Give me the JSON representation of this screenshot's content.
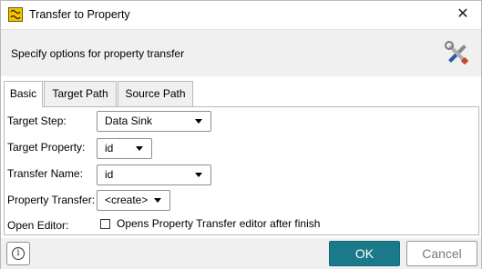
{
  "window": {
    "title": "Transfer to Property"
  },
  "header": {
    "description": "Specify options for property transfer"
  },
  "tabs": [
    {
      "label": "Basic",
      "active": true
    },
    {
      "label": "Target Path",
      "active": false
    },
    {
      "label": "Source Path",
      "active": false
    }
  ],
  "form": {
    "target_step": {
      "label": "Target Step:",
      "value": "Data Sink"
    },
    "target_property": {
      "label": "Target Property:",
      "value": "id"
    },
    "transfer_name": {
      "label": "Transfer Name:",
      "value": "id"
    },
    "property_transfer": {
      "label": "Property Transfer:",
      "value": "<create>"
    },
    "open_editor": {
      "label": "Open Editor:",
      "checkbox_label": "Opens Property Transfer editor after finish",
      "checked": false
    }
  },
  "footer": {
    "info_label": "i",
    "ok_label": "OK",
    "cancel_label": "Cancel"
  },
  "colors": {
    "ok_button": "#1a7a8a",
    "header_bg": "#f0f0f0",
    "app_icon": "#f5c400"
  },
  "icons": {
    "app": "soapui-logo-icon",
    "close": "close-icon",
    "header": "tools-icon",
    "info": "info-icon"
  }
}
